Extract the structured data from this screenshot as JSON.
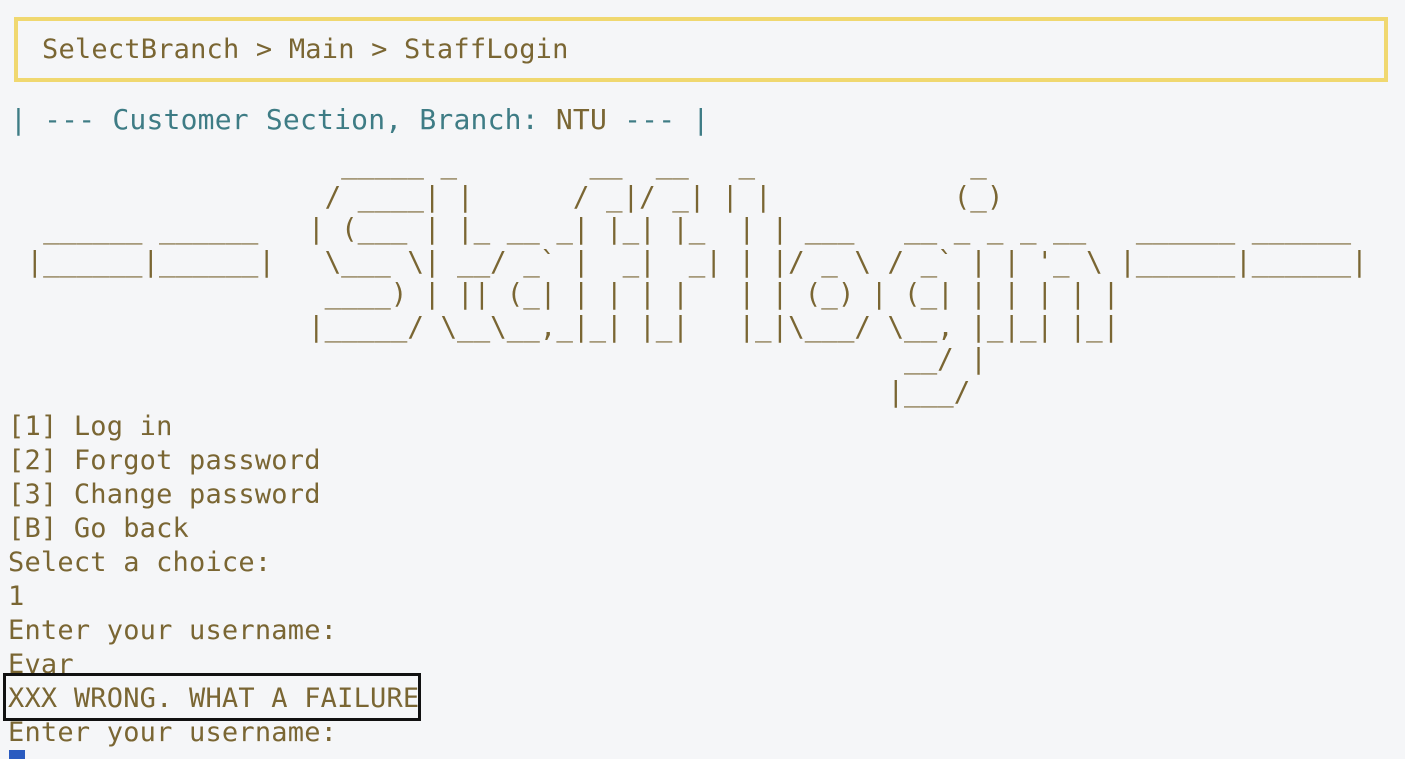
{
  "breadcrumb": "SelectBranch > Main > StaffLogin",
  "section_header": {
    "prefix": "| --- Customer Section, Branch: ",
    "branch": "NTU",
    "suffix": " --- |"
  },
  "banner_art": "                    _____ _        __  __   _             _\n                   / ____| |      / _|/ _| | |           (_)\n  ______ ______   | (___ | |_ __ _| |_| |_  | | ___   __ _ _ _ __   ______ ______\n |______|______|   \\___ \\| __/ _` |  _|  _| | |/ _ \\ / _` | | '_ \\ |______|______|\n                   ____) | || (_| | | | |   | | (_) | (_| | | | | |\n                  |_____/ \\__\\__,_|_| |_|   |_|\\___/ \\__, |_|_| |_|\n                                                      __/ |\n                                                     |___/",
  "menu": [
    "[1] Log in",
    "[2] Forgot password",
    "[3] Change password",
    "[B] Go back"
  ],
  "prompt_choice": "Select a choice:",
  "choice_input": "1",
  "prompt_username": "Enter your username:",
  "username_input": "Evar",
  "error_message": "XXX WRONG. WHAT A FAILURE",
  "prompt_username_again": "Enter your username:",
  "colors": {
    "text": "#7a6633",
    "header": "#3e7c85",
    "breadcrumb_border": "#f0d870",
    "cursor": "#2a5bc0",
    "error_border": "#111111",
    "background": "#f5f6f8"
  }
}
